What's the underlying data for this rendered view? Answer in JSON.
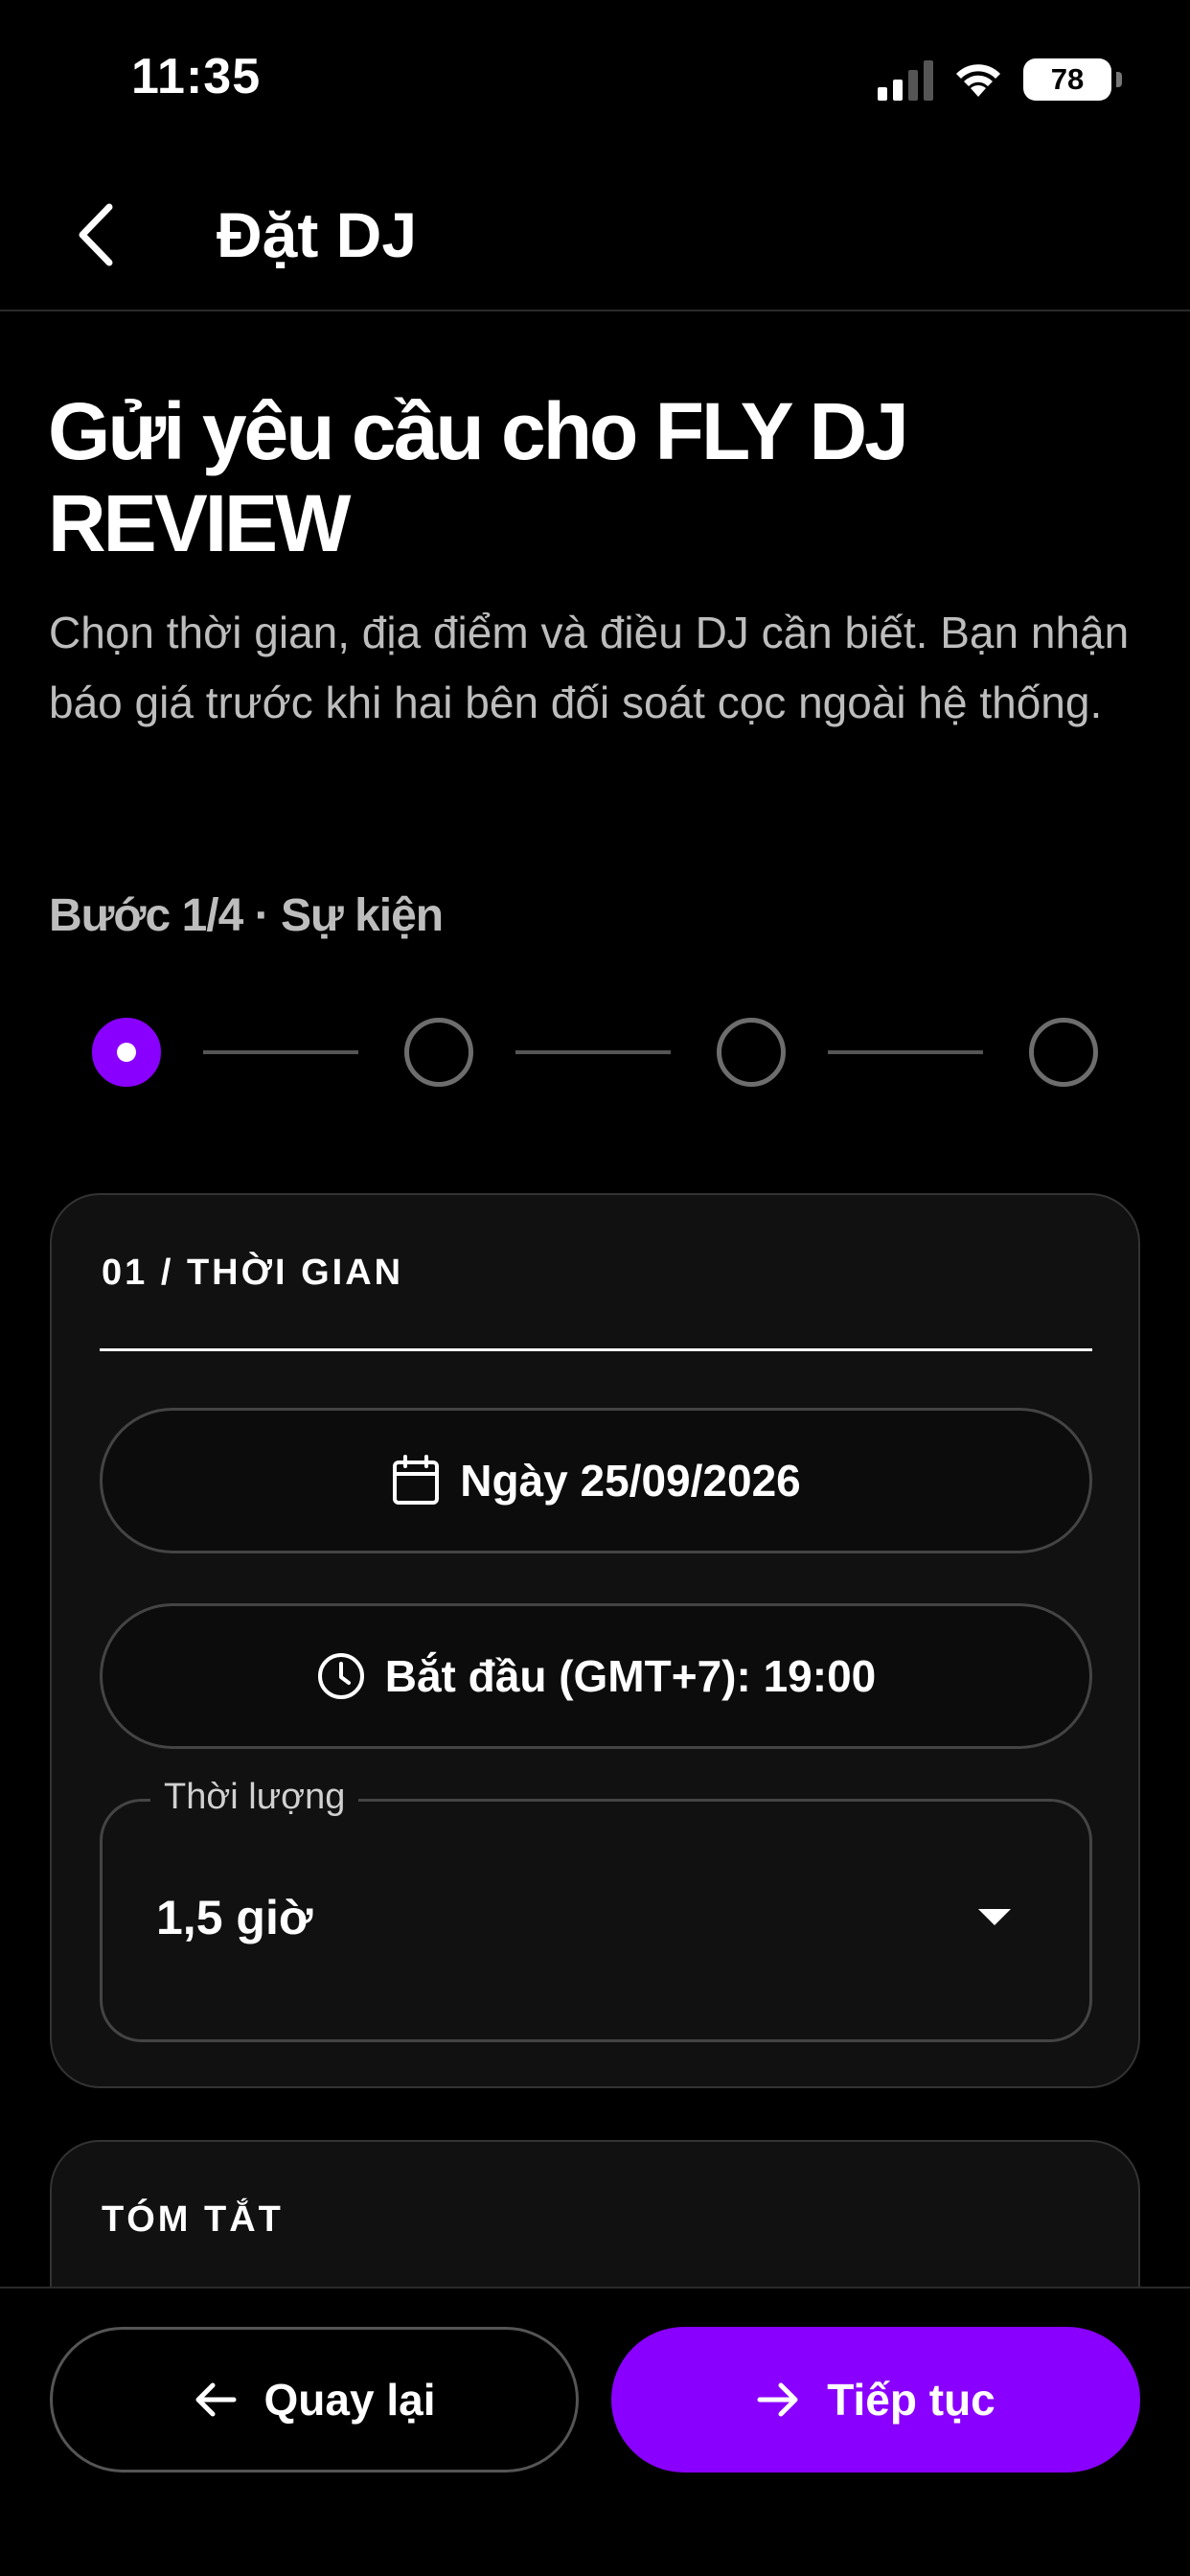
{
  "status_bar": {
    "time": "11:35",
    "battery": "78"
  },
  "header": {
    "title": "Đặt DJ",
    "back_icon": "chevron-left-icon"
  },
  "intro": {
    "title": "Gửi yêu cầu cho FLY DJ REVIEW",
    "subtitle": "Chọn thời gian, địa điểm và điều DJ cần biết. Bạn nhận báo giá trước khi hai bên đối soát cọc ngoài hệ thống.",
    "step_label": "Bước 1/4 · Sự kiện"
  },
  "stepper": {
    "total": 4,
    "current": 1,
    "accent": "#8a00ff"
  },
  "time_card": {
    "heading": "01 / THỜI GIAN",
    "date_label": "Ngày 25/09/2026",
    "date_icon": "calendar-icon",
    "start_label": "Bắt đầu (GMT+7): 19:00",
    "start_icon": "clock-icon",
    "duration": {
      "legend": "Thời lượng",
      "value": "1,5 giờ",
      "icon": "caret-down-icon"
    }
  },
  "summary_card": {
    "heading": "TÓM TẮT",
    "name": "FLY DJ REVIEW"
  },
  "footer": {
    "back_label": "Quay lại",
    "back_icon": "arrow-left-icon",
    "next_label": "Tiếp tục",
    "next_icon": "arrow-right-icon"
  },
  "colors": {
    "background": "#000000",
    "accent": "#8a00ff",
    "card": "#111111",
    "muted_text": "#bdbdbd"
  }
}
